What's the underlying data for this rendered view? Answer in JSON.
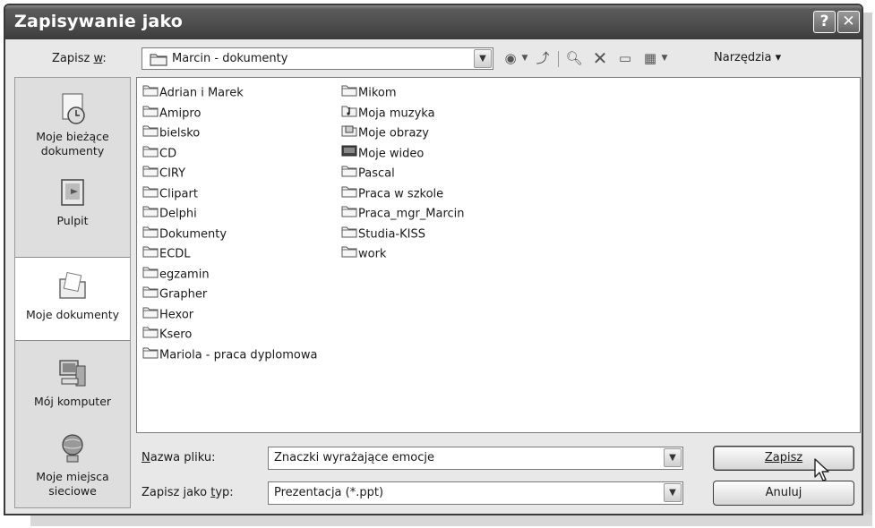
{
  "window": {
    "title": "Zapisywanie jako"
  },
  "title_buttons": {
    "help": "?",
    "close": "✕"
  },
  "save_in": {
    "label": "Zapisz w:",
    "value": "Marcin - dokumenty"
  },
  "toolbar": {
    "tools_label": "Narzędzia"
  },
  "places": [
    {
      "label": "Moje bieżące dokumenty",
      "icon": "recent-documents-icon"
    },
    {
      "label": "Pulpit",
      "icon": "desktop-icon"
    },
    {
      "label": "Moje dokumenty",
      "icon": "my-documents-icon",
      "selected": true
    },
    {
      "label": "Mój komputer",
      "icon": "my-computer-icon"
    },
    {
      "label": "Moje miejsca sieciowe",
      "icon": "network-places-icon"
    }
  ],
  "files_col1": [
    "Adrian i Marek",
    "Amipro",
    "bielsko",
    "CD",
    "CIRY",
    "Clipart",
    "Delphi",
    "Dokumenty",
    "ECDL",
    "egzamin",
    "Grapher",
    "Hexor",
    "Ksero",
    "Mariola - praca dyplomowa"
  ],
  "files_col2": [
    {
      "name": "Mikom",
      "icon": "folder-icon"
    },
    {
      "name": "Moja muzyka",
      "icon": "music-folder-icon"
    },
    {
      "name": "Moje obrazy",
      "icon": "pictures-folder-icon"
    },
    {
      "name": "Moje wideo",
      "icon": "video-folder-icon"
    },
    {
      "name": "Pascal",
      "icon": "folder-icon"
    },
    {
      "name": "Praca w szkole",
      "icon": "folder-icon"
    },
    {
      "name": "Praca_mgr_Marcin",
      "icon": "folder-icon"
    },
    {
      "name": "Studia-KISS",
      "icon": "folder-icon"
    },
    {
      "name": "work",
      "icon": "folder-icon"
    }
  ],
  "filename": {
    "label": "Nazwa pliku:",
    "value": "Znaczki wyrażające emocje"
  },
  "filetype": {
    "label": "Zapisz jako typ:",
    "value": "Prezentacja (*.ppt)"
  },
  "buttons": {
    "save": "Zapisz",
    "cancel": "Anuluj"
  }
}
